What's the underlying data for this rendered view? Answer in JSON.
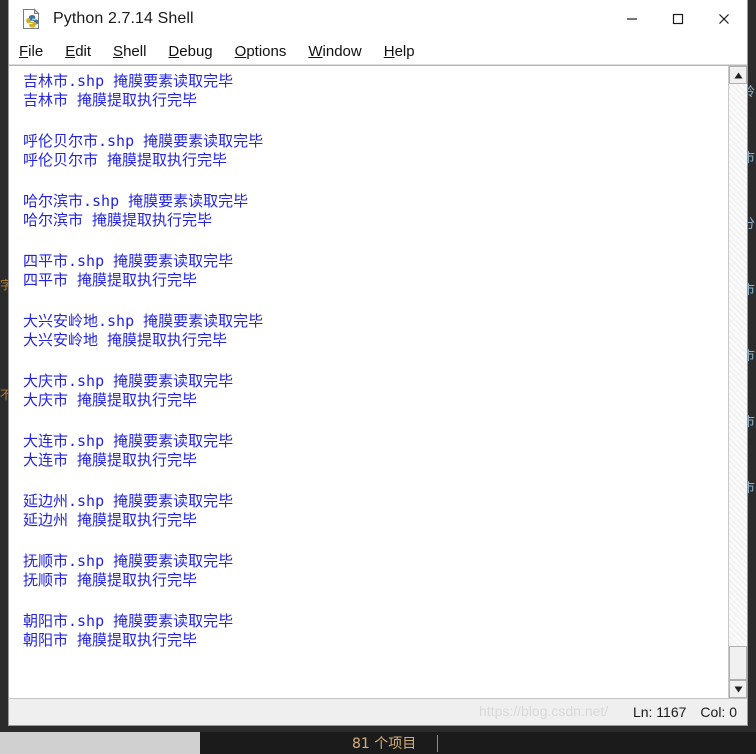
{
  "window": {
    "title": "Python 2.7.14 Shell",
    "icon": "python-idle-icon",
    "controls": {
      "minimize": "—",
      "maximize": "□",
      "close": "✕"
    }
  },
  "menu": [
    {
      "name": "file",
      "accel": "F",
      "rest": "ile"
    },
    {
      "name": "edit",
      "accel": "E",
      "rest": "dit"
    },
    {
      "name": "shell",
      "accel": "S",
      "rest": "hell"
    },
    {
      "name": "debug",
      "accel": "D",
      "rest": "ebug"
    },
    {
      "name": "options",
      "accel": "O",
      "rest": "ptions"
    },
    {
      "name": "window",
      "accel": "W",
      "rest": "indow"
    },
    {
      "name": "help",
      "accel": "H",
      "rest": "elp"
    }
  ],
  "shell": {
    "entries": [
      {
        "read": "吉林市.shp 掩膜要素读取完毕",
        "done": "吉林市 掩膜提取执行完毕"
      },
      {
        "read": "呼伦贝尔市.shp 掩膜要素读取完毕",
        "done": "呼伦贝尔市 掩膜提取执行完毕"
      },
      {
        "read": "哈尔滨市.shp 掩膜要素读取完毕",
        "done": "哈尔滨市 掩膜提取执行完毕"
      },
      {
        "read": "四平市.shp 掩膜要素读取完毕",
        "done": "四平市 掩膜提取执行完毕"
      },
      {
        "read": "大兴安岭地.shp 掩膜要素读取完毕",
        "done": "大兴安岭地 掩膜提取执行完毕"
      },
      {
        "read": "大庆市.shp 掩膜要素读取完毕",
        "done": "大庆市 掩膜提取执行完毕"
      },
      {
        "read": "大连市.shp 掩膜要素读取完毕",
        "done": "大连市 掩膜提取执行完毕"
      },
      {
        "read": "延边州.shp 掩膜要素读取完毕",
        "done": "延边州 掩膜提取执行完毕"
      },
      {
        "read": "抚顺市.shp 掩膜要素读取完毕",
        "done": "抚顺市 掩膜提取执行完毕"
      },
      {
        "read": "朝阳市.shp 掩膜要素读取完毕",
        "done": "朝阳市 掩膜提取执行完毕"
      }
    ],
    "text_color": "#2424e0"
  },
  "scrollbar": {
    "up_arrow": "▲",
    "down_arrow": "▼"
  },
  "status": {
    "line": "Ln: 1167",
    "column": "Col: 0",
    "watermark": "https://blog.csdn.net/"
  },
  "background": {
    "item_count": "81 个项目",
    "right_column_text": "岭\n市\n分\n市\n市\n市\n市",
    "left_column_text": "字\n不"
  }
}
